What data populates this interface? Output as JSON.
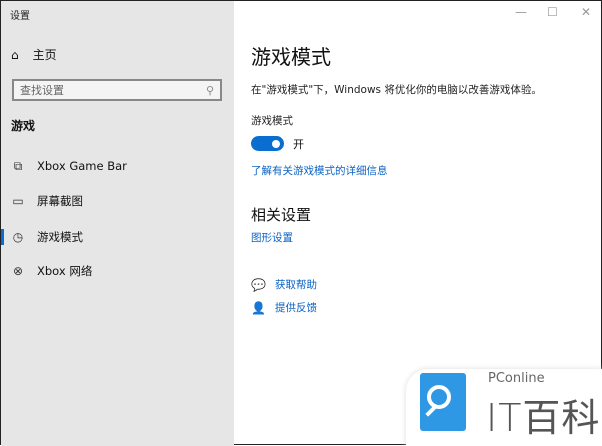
{
  "window": {
    "title": "设置",
    "minimize": "—",
    "maximize": "☐",
    "close": "✕"
  },
  "sidebar": {
    "home": "主页",
    "search_placeholder": "查找设置",
    "section": "游戏",
    "items": [
      {
        "label": "Xbox Game Bar",
        "icon": "game-bar-icon"
      },
      {
        "label": "屏幕截图",
        "icon": "capture-icon"
      },
      {
        "label": "游戏模式",
        "icon": "game-mode-icon",
        "active": true
      },
      {
        "label": "Xbox 网络",
        "icon": "xbox-icon"
      }
    ]
  },
  "main": {
    "title": "游戏模式",
    "description": "在\"游戏模式\"下，Windows 将优化你的电脑以改善游戏体验。",
    "toggle_label": "游戏模式",
    "toggle_on": true,
    "toggle_state": "开",
    "learn_more": "了解有关游戏模式的详细信息",
    "related_title": "相关设置",
    "related_link": "图形设置",
    "help": "获取帮助",
    "feedback": "提供反馈"
  },
  "watermark": {
    "brand": "PConline",
    "name": "IT百科"
  },
  "colors": {
    "accent": "#0a6ed1",
    "sidebar_bg": "#e6e6e6"
  }
}
